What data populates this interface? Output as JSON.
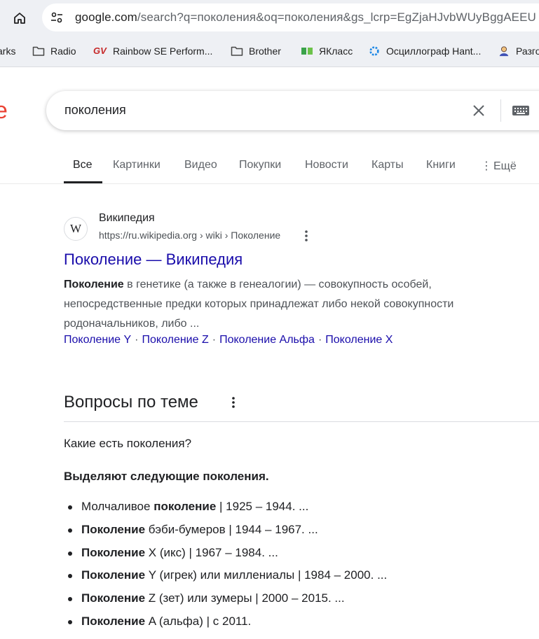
{
  "browser": {
    "url_host": "google.com",
    "url_path": "/search?q=поколения&oq=поколения&gs_lcrp=EgZjaHJvbWUyBggAEEU"
  },
  "bookmarks": [
    {
      "label": "arks",
      "icon": "bookmark-cut-icon"
    },
    {
      "label": "Radio",
      "icon": "folder-icon"
    },
    {
      "label": "Rainbow SE Perform...",
      "icon": "gv-logo-icon"
    },
    {
      "label": "Brother",
      "icon": "folder-icon"
    },
    {
      "label": "ЯКласс",
      "icon": "yaklass-icon"
    },
    {
      "label": "Осциллограф Hant...",
      "icon": "gear-spinner-icon"
    },
    {
      "label": "Разго",
      "icon": "person-icon"
    }
  ],
  "search": {
    "query": "поколения",
    "logo_fragment": "e"
  },
  "tabs": [
    {
      "label": "Все",
      "active": true
    },
    {
      "label": "Картинки"
    },
    {
      "label": "Видео"
    },
    {
      "label": "Покупки"
    },
    {
      "label": "Новости"
    },
    {
      "label": "Карты"
    },
    {
      "label": "Книги"
    },
    {
      "label": "Ещё"
    }
  ],
  "result": {
    "favicon_letter": "W",
    "site_name": "Википедия",
    "site_url": "https://ru.wikipedia.org › wiki › Поколение",
    "title": "Поколение — Википедия",
    "snippet_bold": "Поколение",
    "snippet_rest": " в генетике (а также в генеалогии) — совокупность особей, непосредственные предки которых принадлежат либо некой совокупности родоначальников, либо ...",
    "sitelinks": [
      "Поколение Y",
      "Поколение Z",
      "Поколение Альфа",
      "Поколение X"
    ],
    "sitelink_separator": "·"
  },
  "paa": {
    "title": "Вопросы по теме",
    "question": "Какие есть поколения?",
    "answer_heading": "Выделяют следующие поколения.",
    "items": [
      {
        "pre": "Молчаливое ",
        "bold": "поколение",
        "post": " | 1925 – 1944. ..."
      },
      {
        "pre": "",
        "bold": "Поколение",
        "post": " бэби-бумеров | 1944 – 1967. ..."
      },
      {
        "pre": "",
        "bold": "Поколение",
        "post": " X (икс) | 1967 – 1984. ..."
      },
      {
        "pre": "",
        "bold": "Поколение",
        "post": " Y (игрек) или миллениалы | 1984 – 2000. ..."
      },
      {
        "pre": "",
        "bold": "Поколение",
        "post": " Z (зет) или зумеры | 2000 – 2015. ..."
      },
      {
        "pre": "",
        "bold": "Поколение",
        "post": " A (альфа) | с 2011."
      }
    ]
  },
  "colors": {
    "link": "#1a0dab",
    "snippet": "#4d5156",
    "browser_chrome": "#eef0f4",
    "google_red": "#ea4335"
  }
}
